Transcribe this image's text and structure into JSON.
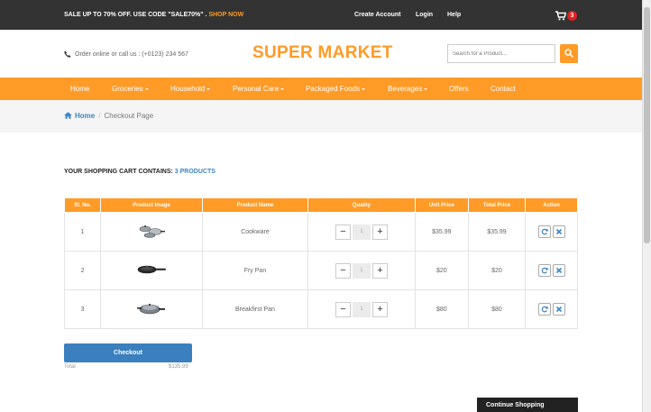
{
  "topbar": {
    "promo_text": "SALE UP TO 70% OFF. USE CODE \"SALE70%\" .",
    "promo_link": "SHOP NOW",
    "create_account": "Create Account",
    "login": "Login",
    "help": "Help",
    "cart_count": "3"
  },
  "header": {
    "phone_text": "Order online or call us : (+0123) 234 567",
    "logo": "SUPER MARKET",
    "search_placeholder": "Search for a Product..."
  },
  "nav": {
    "items": [
      "Home",
      "Groceries",
      "Household",
      "Personal Care",
      "Packaged Foods",
      "Beverages",
      "Offers",
      "Contact"
    ]
  },
  "breadcrumb": {
    "home": "Home",
    "separator": "/",
    "current": "Checkout Page"
  },
  "cart": {
    "heading": "YOUR SHOPPING CART CONTAINS:",
    "count_text": "3 PRODUCTS",
    "columns": [
      "Sl. No.",
      "Product Image",
      "Product Name",
      "Quality",
      "Unit Price",
      "Total Price",
      "Action"
    ],
    "rows": [
      {
        "sl": "1",
        "name": "Cookware",
        "qty": "1",
        "unit_price": "$35.99",
        "total_price": "$35.99",
        "image_icon": "cookware-icon"
      },
      {
        "sl": "2",
        "name": "Fry Pan",
        "qty": "1",
        "unit_price": "$20",
        "total_price": "$20",
        "image_icon": "fry-pan-icon"
      },
      {
        "sl": "3",
        "name": "Breakfirst Pan",
        "qty": "1",
        "unit_price": "$80",
        "total_price": "$80",
        "image_icon": "breakfast-pan-icon"
      }
    ],
    "minus_symbol": "−",
    "plus_symbol": "+"
  },
  "checkout": {
    "button": "Checkout",
    "total_label": "Total",
    "total_value": "$135.99"
  },
  "continue_shopping": "Continue Shopping",
  "colors": {
    "accent": "#ff9b26",
    "link": "#3b86c5",
    "topbar": "#333333",
    "checkout": "#3b7fbf",
    "badge": "#e02020"
  }
}
